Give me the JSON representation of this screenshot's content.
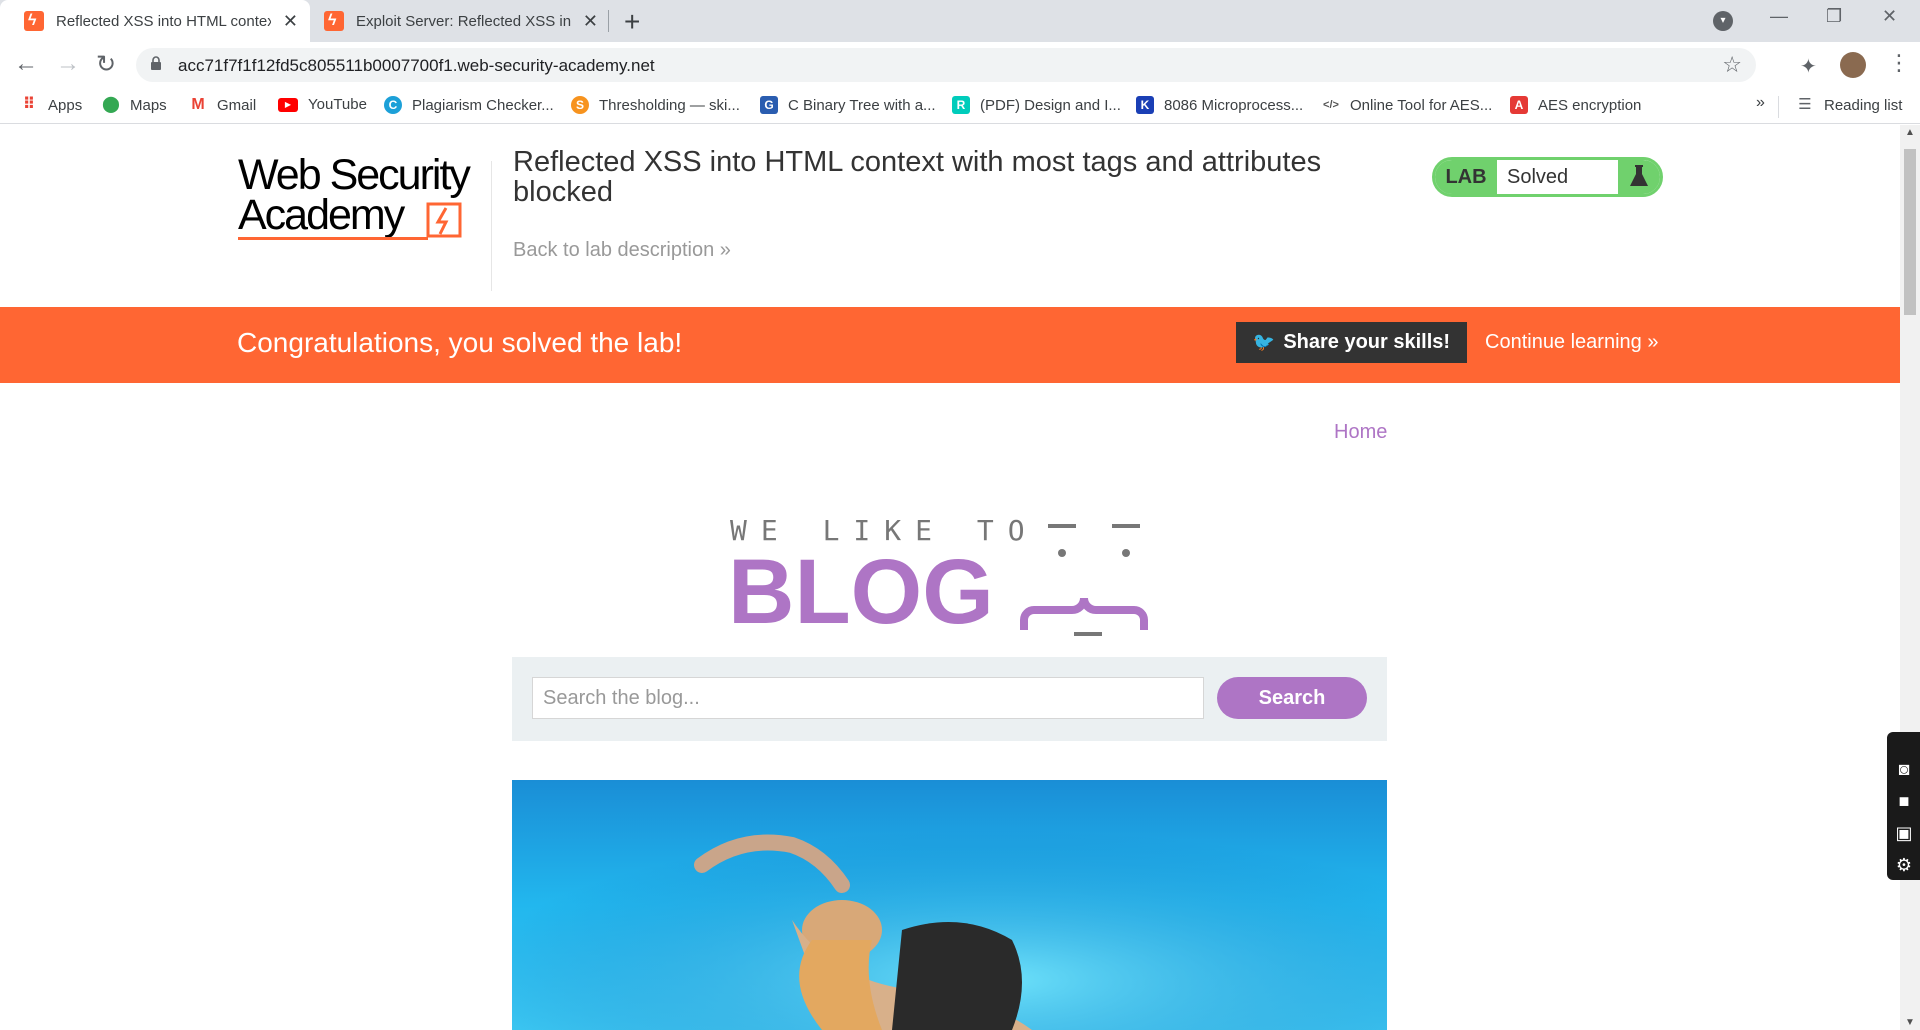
{
  "browser": {
    "tabs": [
      {
        "title": "Reflected XSS into HTML context with most tags and attributes blocked",
        "active": true
      },
      {
        "title": "Exploit Server: Reflected XSS into HTML context with most tags and attributes blocked",
        "active": false
      }
    ],
    "url": "acc71f7f1f12fd5c805511b0007700f1.web-security-academy.net",
    "bookmarks": [
      {
        "label": "Apps",
        "icon": "apps-grid-icon"
      },
      {
        "label": "Maps",
        "icon": "maps-pin-icon"
      },
      {
        "label": "Gmail",
        "icon": "gmail-icon"
      },
      {
        "label": "YouTube",
        "icon": "youtube-icon"
      },
      {
        "label": "Plagiarism Checker...",
        "icon": "plagiarism-icon"
      },
      {
        "label": "Thresholding — ski...",
        "icon": "thresholding-icon"
      },
      {
        "label": "C Binary Tree with a...",
        "icon": "binary-tree-icon"
      },
      {
        "label": "(PDF) Design and I...",
        "icon": "researchgate-icon"
      },
      {
        "label": "8086 Microprocess...",
        "icon": "microprocessor-icon"
      },
      {
        "label": "Online Tool for AES...",
        "icon": "code-icon"
      },
      {
        "label": "AES encryption",
        "icon": "aes-icon"
      }
    ],
    "more_label": "»",
    "reading_list": "Reading list"
  },
  "header": {
    "logo_line1": "Web Security",
    "logo_line2": "Academy",
    "lab_title": "Reflected XSS into HTML context with most tags and attributes blocked",
    "back_link": "Back to lab description »",
    "badge_lab": "LAB",
    "badge_status": "Solved"
  },
  "banner": {
    "message": "Congratulations, you solved the lab!",
    "share_label": "Share your skills!",
    "continue_label": "Continue learning »"
  },
  "blog": {
    "home_link": "Home",
    "logo_top": "WE LIKE TO",
    "logo_main": "BLOG",
    "search_placeholder": "Search the blog...",
    "search_button": "Search"
  },
  "colors": {
    "orange": "#ff6633",
    "green": "#70d16d",
    "purple": "#ae75c5",
    "dark": "#333333"
  }
}
